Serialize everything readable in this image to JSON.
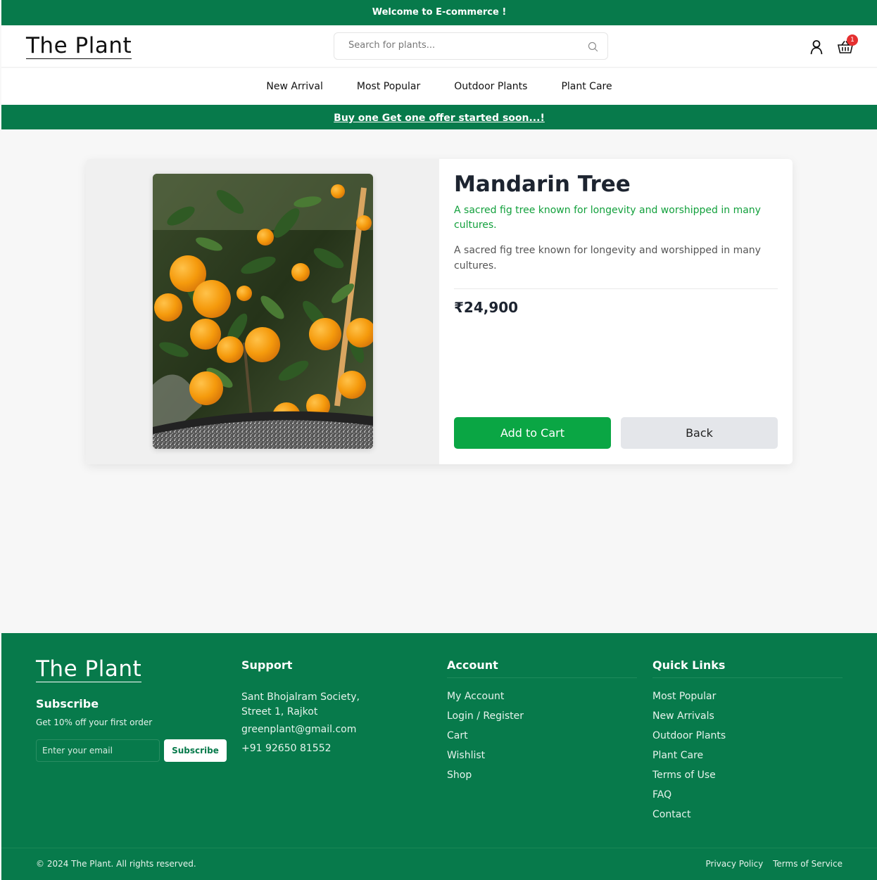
{
  "topbar": {
    "text": "Welcome to E-commerce !"
  },
  "header": {
    "logo": "The Plant",
    "search_placeholder": "Search for plants...",
    "cart_count": "1"
  },
  "nav": {
    "items": [
      {
        "label": "New Arrival"
      },
      {
        "label": "Most Popular"
      },
      {
        "label": "Outdoor Plants"
      },
      {
        "label": "Plant Care"
      }
    ]
  },
  "promo": {
    "text": "Buy one Get one offer started soon...!"
  },
  "product": {
    "name": "Mandarin Tree",
    "tagline": "A sacred fig tree known for longevity and worshipped in many cultures.",
    "description": "A sacred fig tree known for longevity and worshipped in many cultures.",
    "price": "₹24,900",
    "add_to_cart_label": "Add to Cart",
    "back_label": "Back"
  },
  "footer": {
    "logo": "The Plant",
    "subscribe": {
      "title": "Subscribe",
      "text": "Get 10% off your first order",
      "placeholder": "Enter your email",
      "button": "Subscribe"
    },
    "support": {
      "title": "Support",
      "address": "Sant Bhojalram Society, Street 1, Rajkot",
      "email": "greenplant@gmail.com",
      "phone": "+91 92650 81552"
    },
    "account": {
      "title": "Account",
      "links": [
        "My Account",
        "Login / Register",
        "Cart",
        "Wishlist",
        "Shop"
      ]
    },
    "quick_links": {
      "title": "Quick Links",
      "links": [
        "Most Popular",
        "New Arrivals",
        "Outdoor Plants",
        "Plant Care",
        "Terms of Use",
        "FAQ",
        "Contact"
      ]
    },
    "copyright": "© 2024 The Plant. All rights reserved.",
    "legal": [
      "Privacy Policy",
      "Terms of Service"
    ]
  },
  "colors": {
    "brand_green": "#077a4b",
    "accent_green": "#0aa644",
    "badge_red": "#e53030"
  },
  "icons": [
    "search-icon",
    "user-icon",
    "cart-icon"
  ]
}
